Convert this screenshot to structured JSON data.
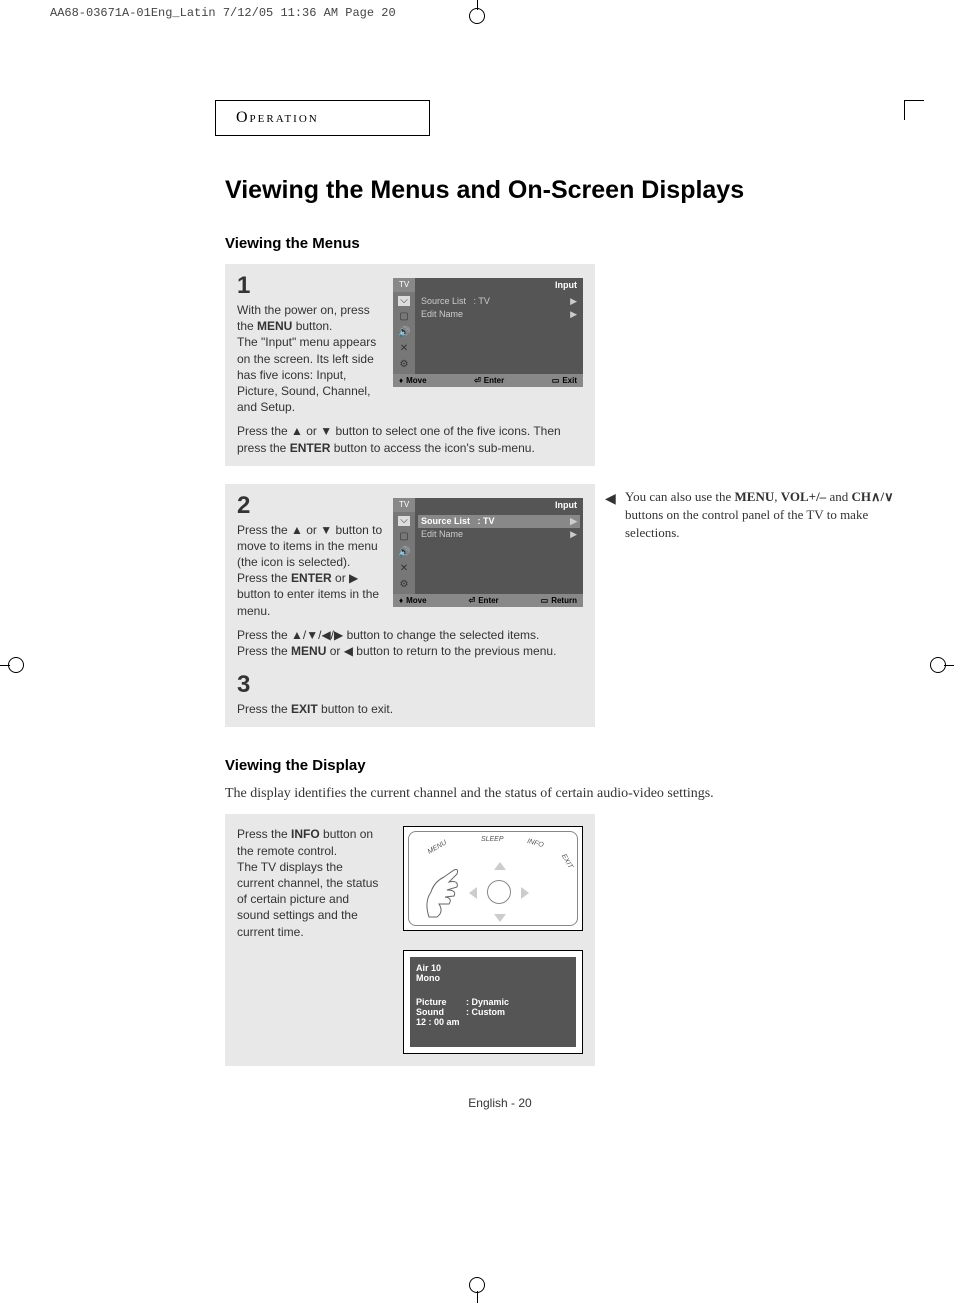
{
  "print_header": "AA68-03671A-01Eng_Latin  7/12/05  11:36 AM  Page 20",
  "section_tab": "Operation",
  "main_heading": "Viewing the Menus and On-Screen Displays",
  "sub1": "Viewing the Menus",
  "step1": {
    "num": "1",
    "text_pre": "With the power on, press the ",
    "menu": "MENU",
    "text_post": " button.\nThe \"Input\" menu appears on the screen. Its left side has five icons: Input, Picture, Sound, Channel, and Setup."
  },
  "osd1": {
    "tv": "TV",
    "title": "Input",
    "line1_label": "Source List",
    "line1_value": ": TV",
    "line2_label": "Edit Name",
    "footer_move": "Move",
    "footer_enter": "Enter",
    "footer_exit": "Exit"
  },
  "step1_below_pre": "Press the ▲ or ▼ button to select one of the five icons. Then press the ",
  "enter": "ENTER",
  "step1_below_post": " button to access the icon's sub-menu.",
  "step2": {
    "num": "2",
    "t1": "Press the ▲ or ▼ button to move to items in the menu (the icon is selected).",
    "t2_pre": "Press the ",
    "t2_post": " or ▶ button to enter items in the menu.",
    "t3": "Press the ▲/▼/◀/▶ button to change the selected items.",
    "t4_pre": "Press the ",
    "menu": "MENU",
    "t4_post": " or ◀ button to return to the previous menu."
  },
  "osd2": {
    "tv": "TV",
    "title": "Input",
    "line1_label": "Source List",
    "line1_value": ": TV",
    "line2_label": "Edit Name",
    "footer_move": "Move",
    "footer_enter": "Enter",
    "footer_return": "Return"
  },
  "step3": {
    "num": "3",
    "text_pre": "Press the ",
    "exit": "EXIT",
    "text_post": " button to exit."
  },
  "side_note": {
    "pre": "You can also use the ",
    "menu": "MENU",
    "mid1": ", ",
    "vol": "VOL+/–",
    "mid2": " and ",
    "ch": "CH",
    "ch_sym": "∧/∨",
    "post": " buttons on the control panel of the TV to make selections."
  },
  "sub2": "Viewing the Display",
  "desc": "The display identifies the current channel and the status of certain audio-video settings.",
  "info_step_pre": "Press the ",
  "info": "INFO",
  "info_step_post": " button on the remote control.\nThe TV displays the current channel, the status of certain picture and sound settings and the current time.",
  "remote": {
    "menu": "MENU",
    "sleep": "SLEEP",
    "info": "INFO",
    "exit": "EXIT"
  },
  "info_osd": {
    "channel": "Air  10",
    "audio": "Mono",
    "picture_k": "Picture",
    "picture_v": ":  Dynamic",
    "sound_k": "Sound",
    "sound_v": ":  Custom",
    "time": "12 : 00 am"
  },
  "page_num_pre": "English - ",
  "page_num": "20"
}
